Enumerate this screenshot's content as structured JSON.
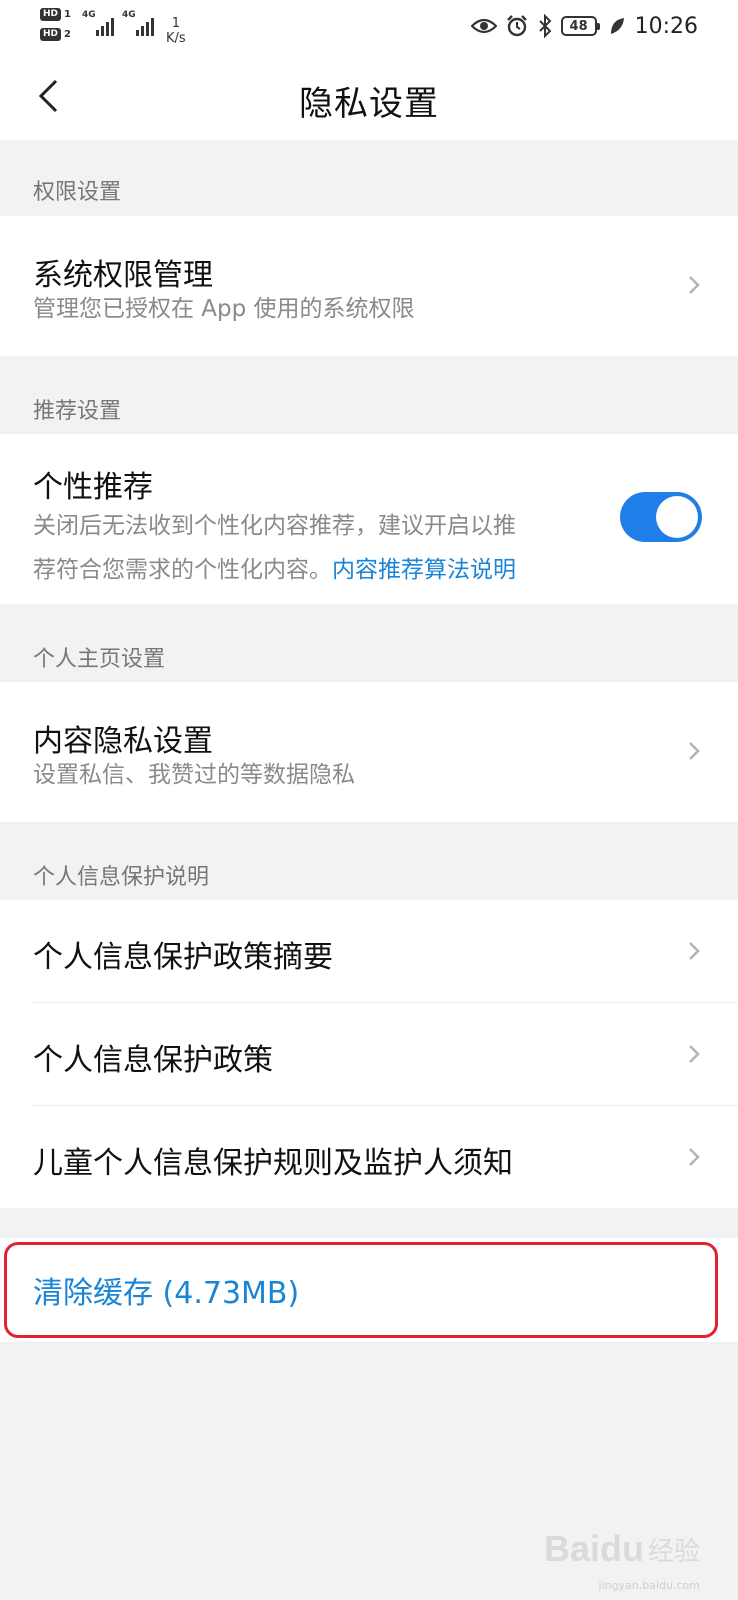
{
  "status_bar": {
    "sim1_badge": "HD",
    "sim1_num": "1",
    "sim2_badge": "HD",
    "sim2_num": "2",
    "sim1_network": "4G",
    "sim2_network": "4G",
    "speed_value": "1",
    "speed_unit": "K/s",
    "battery": "48",
    "time": "10:26",
    "icons": [
      "eye-icon",
      "alarm-icon",
      "bluetooth-icon",
      "battery-icon",
      "leaf-icon"
    ]
  },
  "nav": {
    "title": "隐私设置",
    "back_icon": "chevron-left-icon"
  },
  "sections": {
    "permissions": {
      "header": "权限设置",
      "item_title": "系统权限管理",
      "item_sub": "管理您已授权在 App 使用的系统权限"
    },
    "recommend": {
      "header": "推荐设置",
      "item_title": "个性推荐",
      "item_sub_line1": "关闭后无法收到个性化内容推荐，建议开启以推",
      "item_sub_line2": "荐符合您需求的个性化内容。",
      "item_link": "内容推荐算法说明",
      "toggle_on": true
    },
    "homepage": {
      "header": "个人主页设置",
      "item_title": "内容隐私设置",
      "item_sub": "设置私信、我赞过的等数据隐私"
    },
    "info_protection": {
      "header": "个人信息保护说明",
      "items": [
        "个人信息保护政策摘要",
        "个人信息保护政策",
        "儿童个人信息保护规则及监护人须知"
      ]
    }
  },
  "clear_cache": {
    "label": "清除缓存 (4.73MB)"
  },
  "watermark": {
    "brand": "Baidu",
    "cn": "经验",
    "url": "jingyan.baidu.com"
  },
  "colors": {
    "accent_blue": "#1a84d6",
    "toggle_blue": "#1f7ee8",
    "highlight_red": "#e0232f",
    "background": "#f2f2f2"
  }
}
